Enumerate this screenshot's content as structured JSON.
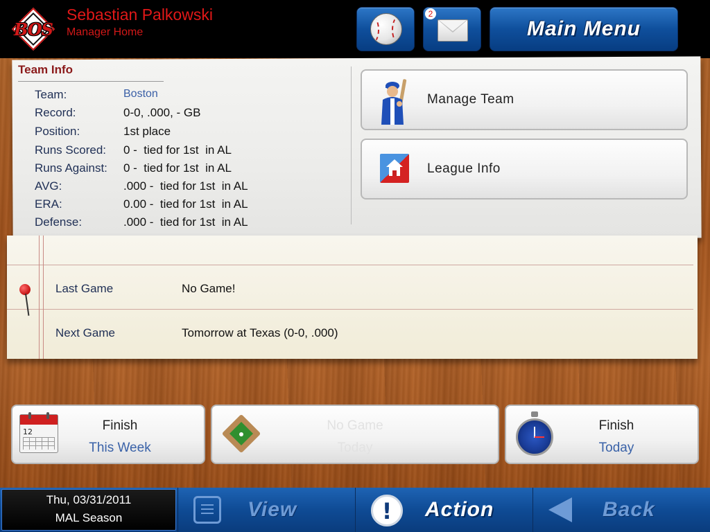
{
  "header": {
    "team_abbr": "BOS",
    "manager_name": "Sebastian Palkowski",
    "subtitle": "Manager Home",
    "mail_count": "2",
    "main_menu_label": "Main Menu"
  },
  "team_info": {
    "title": "Team Info",
    "rows": [
      {
        "label": "Team:",
        "value": "Boston"
      },
      {
        "label": "Record:",
        "value": "0-0, .000, - GB"
      },
      {
        "label": "Position:",
        "value": "1st place"
      },
      {
        "label": "Runs Scored:",
        "value": "0 -  tied for 1st  in AL"
      },
      {
        "label": "Runs Against:",
        "value": "0 -  tied for 1st  in AL"
      },
      {
        "label": "AVG:",
        "value": ".000 -  tied for 1st  in AL"
      },
      {
        "label": "ERA:",
        "value": "0.00 -  tied for 1st  in AL"
      },
      {
        "label": "Defense:",
        "value": ".000 -  tied for 1st  in AL"
      }
    ]
  },
  "side_buttons": {
    "manage_team": "Manage Team",
    "league_info": "League Info"
  },
  "schedule": {
    "last_game_label": "Last Game",
    "last_game_value": "No Game!",
    "next_game_label": "Next Game",
    "next_game_value": "Tomorrow at Texas (0-0, .000)"
  },
  "cards": {
    "finish_week": {
      "line1": "Finish",
      "line2": "This Week"
    },
    "play_game": {
      "line1": "No Game",
      "line2": "Today"
    },
    "finish_today": {
      "line1": "Finish",
      "line2": "Today"
    },
    "calendar_day": "12"
  },
  "bottom_bar": {
    "date": "Thu, 03/31/2011",
    "season": "MAL Season",
    "view_label": "View",
    "action_label": "Action",
    "back_label": "Back"
  },
  "colors": {
    "accent_blue": "#0f4b95",
    "header_red": "#e01818",
    "wood": "#a9581f"
  }
}
